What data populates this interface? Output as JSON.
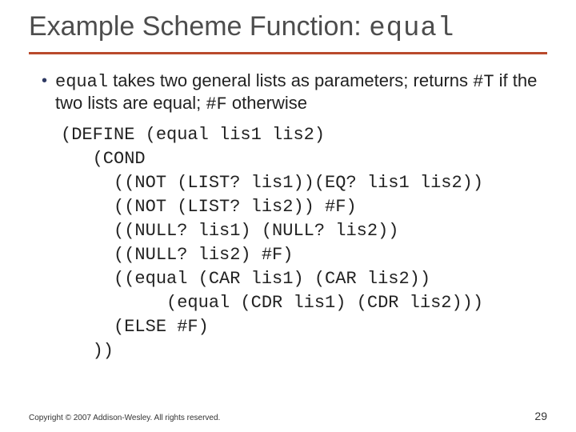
{
  "title": {
    "plain": "Example Scheme Function: ",
    "mono": "equal"
  },
  "bullet": {
    "mono1": "equal",
    "t1": " takes two general lists as parameters; returns ",
    "mono2": "#T",
    "t2": " if the two lists are equal; ",
    "mono3": "#F",
    "t3": " otherwise"
  },
  "code": {
    "l0": "(DEFINE (equal lis1 lis2)",
    "l1": "   (COND",
    "l2": "     ((NOT (LIST? lis1))(EQ? lis1 lis2))",
    "l3": "     ((NOT (LIST? lis2)) #F)",
    "l4": "     ((NULL? lis1) (NULL? lis2))",
    "l5": "     ((NULL? lis2) #F)",
    "l6": "     ((equal (CAR lis1) (CAR lis2))",
    "l7": "          (equal (CDR lis1) (CDR lis2)))",
    "l8": "     (ELSE #F)",
    "l9": "   ))"
  },
  "footer": {
    "copyright": "Copyright © 2007 Addison-Wesley. All rights reserved.",
    "page": "29"
  }
}
